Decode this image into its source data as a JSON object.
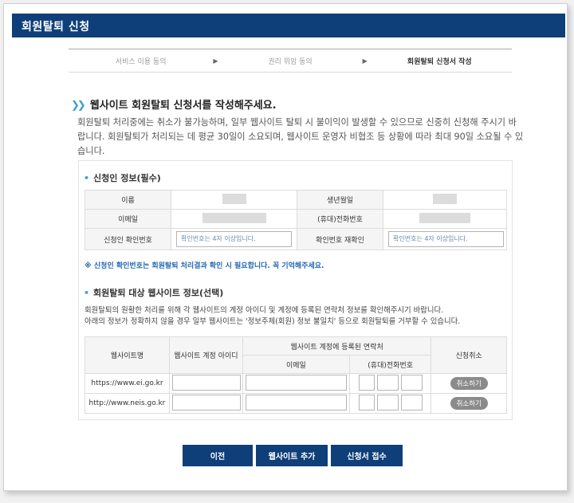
{
  "window": {
    "title": "회원탈퇴 신청"
  },
  "steps": [
    {
      "label": "서비스 이용 동의"
    },
    {
      "label": "권리 위임 동의"
    },
    {
      "label": "회원탈퇴 신청서 작성"
    }
  ],
  "intro": {
    "heading": "웹사이트 회원탈퇴 신청서를 작성해주세요.",
    "text": "회원탈퇴 처리중에는 취소가 불가능하며, 일부 웹사이트 탈퇴 시 불이익이 발생할 수 있으므로 신중히 신청해 주시기 바랍니다. 회원탈퇴가 처리되는 데 평균 30일이 소요되며, 웹사이트 운영자 비협조 등 상황에 따라 최대 90일 소요될 수 있습니다."
  },
  "applicant": {
    "section_title": "신청인 정보(필수)",
    "labels": {
      "name": "이름",
      "birth": "생년월일",
      "email": "이메일",
      "phone": "(휴대)전화번호",
      "confirm_no": "신청인 확인번호",
      "confirm_no_again": "확인번호 재확인"
    },
    "confirm_placeholder": "확인번호는 4자 이상입니다.",
    "note": "※ 신청인 확인번호는 회원탈퇴 처리결과 확인 시 필요합니다. 꼭 기억해주세요."
  },
  "websites": {
    "section_title": "회원탈퇴 대상 웹사이트 정보(선택)",
    "desc_lines": [
      "회원탈퇴의 원활한 처리를 위해 각 웹사이트의 계정 아이디 및 계정에 등록된 연락처 정보를 확인해주시기 바랍니다.",
      "아래의 정보가 정확하지 않을 경우 일부 웹사이트는 '정보주체(회원) 정보 불일치' 등으로 회원탈퇴를 거부할 수 있습니다."
    ],
    "headers": {
      "site": "웹사이트명",
      "account_id": "웹사이트 계정 아이디",
      "contact": "웹사이트 계정에 등록된 연락처",
      "email": "이메일",
      "phone": "(휴대)전화번호",
      "cancel": "신청취소"
    },
    "rows": [
      {
        "site": "https://www.ei.go.kr",
        "cancel_label": "취소하기"
      },
      {
        "site": "http://www.neis.go.kr",
        "cancel_label": "취소하기"
      }
    ]
  },
  "buttons": {
    "prev": "이전",
    "add_site": "웹사이트 추가",
    "submit": "신청서 접수"
  },
  "colors": {
    "brand": "#0f3f78",
    "accent": "#39a0ce",
    "note": "#2468b1"
  }
}
